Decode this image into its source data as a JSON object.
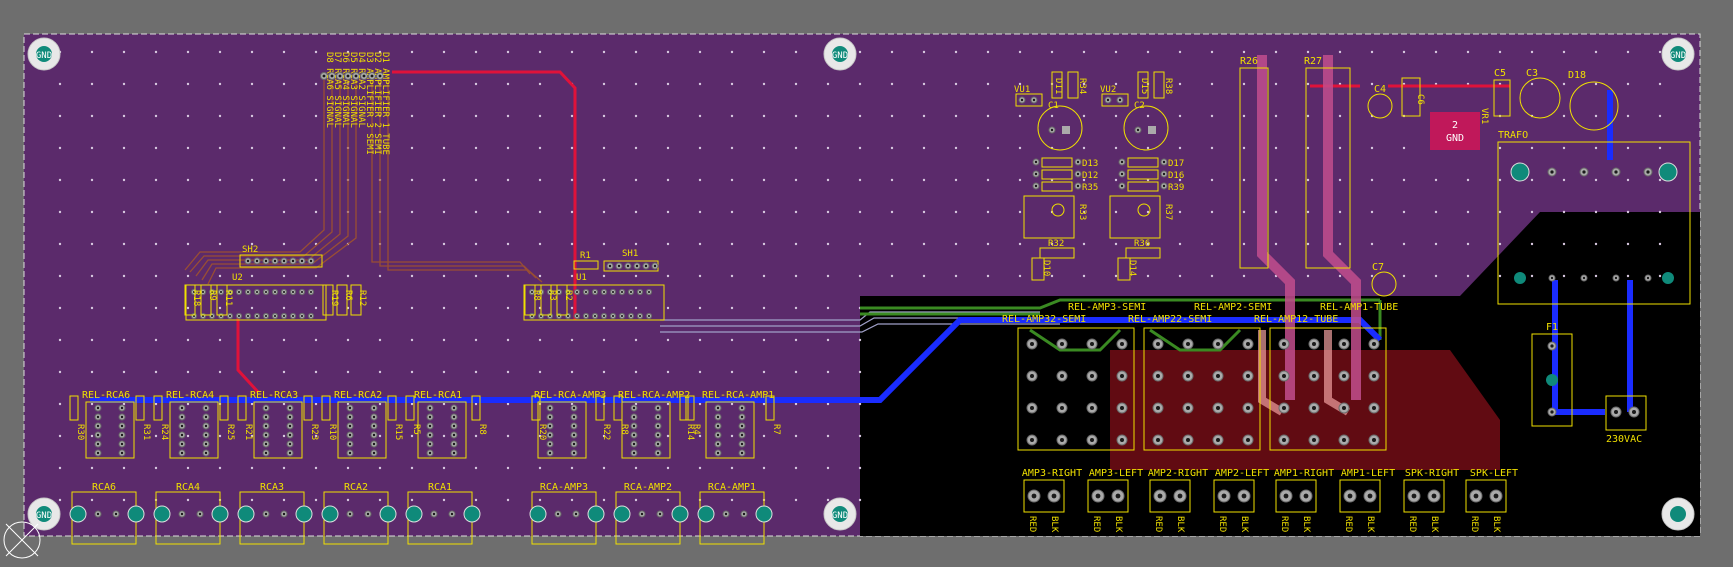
{
  "colors": {
    "background": "#6e6e6e",
    "board": "#5b2a6b",
    "copper_pour": "#000000",
    "top_trace": "#e0123a",
    "bottom_trace": "#1a2cff",
    "silkscreen": "#f0e000",
    "hot_trace": "#c24e8e",
    "green_trace": "#3a8a22",
    "pad": "#aaaaaa",
    "via": "#0f8a7a"
  },
  "mounting_holes": [
    "GND",
    "GND",
    "GND",
    "GND",
    "GND"
  ],
  "header_labels": [
    "D8 RCA6 SIGNAL",
    "D7 RCA5 SIGNAL",
    "D6 RCA4 SIGNAL",
    "D5 RCA3 SIGNAL",
    "D4 RCA2 SIGNAL",
    "D3 AMPLIFIER 3 SEMI",
    "D2 AMPLIFIER 2 SEMI",
    "D1 AMPLIFIER 1 TUBE"
  ],
  "left_parts": [
    "SH2",
    "U2",
    "R18",
    "R9",
    "R11",
    "R19",
    "R6",
    "R12",
    "R1",
    "SH1",
    "U1",
    "R8",
    "R3",
    "R2"
  ],
  "relay_labels": [
    "REL-RCA6",
    "REL-RCA4",
    "REL-RCA3",
    "REL-RCA2",
    "REL-RCA1",
    "REL-RCA-AMP3",
    "REL-RCA-AMP2",
    "REL-RCA-AMP1"
  ],
  "relay_resistors": [
    "R30",
    "R31",
    "R24",
    "R25",
    "R21",
    "R23",
    "R10",
    "R15",
    "R5",
    "R8",
    "R20",
    "R22",
    "R8",
    "R14",
    "R4",
    "R7"
  ],
  "rca_labels": [
    "RCA6",
    "RCA4",
    "RCA3",
    "RCA2",
    "RCA1",
    "RCA-AMP3",
    "RCA-AMP2",
    "RCA-AMP1"
  ],
  "vu_parts": [
    "VU1",
    "D11",
    "R34",
    "C1",
    "D13",
    "D12",
    "R35",
    "R33",
    "R32",
    "D10",
    "VU2",
    "D15",
    "R38",
    "C2",
    "D17",
    "D16",
    "R39",
    "R37",
    "R36",
    "D14"
  ],
  "power_parts": [
    "R26",
    "R27",
    "C4",
    "C6",
    "VR1",
    "C5",
    "C3",
    "D18",
    "TRAFO",
    "C7",
    "F1",
    "230VAC"
  ],
  "vr_label": "2\nGND",
  "amp_relay_labels": [
    "REL-AMP3-SEMI",
    "REL-AMP2-SEMI",
    "REL-AMP1-TUBE",
    "REL-AMP32-SEMI",
    "REL-AMP22-SEMI",
    "REL-AMP12-TUBE"
  ],
  "speaker_labels": [
    "AMP3-RIGHT",
    "AMP3-LEFT",
    "AMP2-RIGHT",
    "AMP2-LEFT",
    "AMP1-RIGHT",
    "AMP1-LEFT",
    "SPK-RIGHT",
    "SPK-LEFT"
  ],
  "wire_labels": [
    "RED",
    "BLK"
  ]
}
